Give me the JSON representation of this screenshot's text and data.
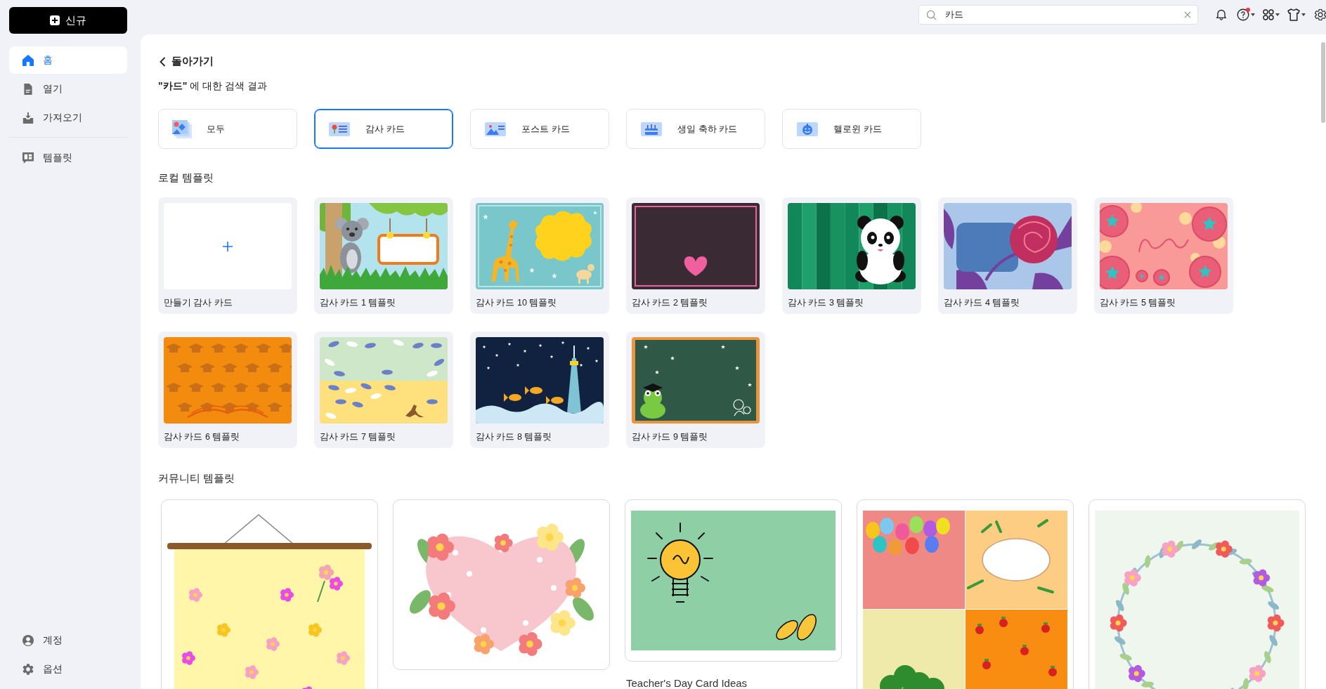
{
  "sidebar": {
    "new_button": "신규",
    "main_items": [
      {
        "label": "홈",
        "selected": true
      },
      {
        "label": "열기",
        "selected": false
      },
      {
        "label": "가져오기",
        "selected": false
      }
    ],
    "template_items": [
      {
        "label": "템플릿",
        "selected": false
      }
    ],
    "footer_items": [
      {
        "label": "계정",
        "selected": false
      },
      {
        "label": "옵션",
        "selected": false
      }
    ]
  },
  "header": {
    "search": {
      "value": "카드"
    },
    "help": {
      "notification": true
    }
  },
  "back_link": "돌아가기",
  "results_heading": "**\"카드\"** 에 대한 검색 결과",
  "categories": [
    {
      "label": "모두",
      "selected": false
    },
    {
      "label": "감사 카드",
      "selected": true
    },
    {
      "label": "포스트 카드",
      "selected": false
    },
    {
      "label": "생일 축하 카드",
      "selected": false
    },
    {
      "label": "핼로윈 카드",
      "selected": false
    }
  ],
  "local_templates": {
    "title": "로컬 템플릿",
    "create_card": "만들기 감사 카드",
    "items": [
      {
        "kind": "koala",
        "label": "감사 카드 1 템플릿"
      },
      {
        "kind": "giraffe",
        "label": "감사 카드 10 템플릿"
      },
      {
        "kind": "heart",
        "label": "감사 카드 2 템플릿"
      },
      {
        "kind": "panda",
        "label": "감사 카드 3 템플릿"
      },
      {
        "kind": "rose",
        "label": "감사 카드 4 템플릿"
      },
      {
        "kind": "dots",
        "label": "감사 카드 5 템플릿"
      },
      {
        "kind": "graduation",
        "label": "감사 카드 6 템플릿"
      },
      {
        "kind": "footprints",
        "label": "감사 카드 7 템플릿"
      },
      {
        "kind": "lighthouse",
        "label": "감사 카드 8 템플릿"
      },
      {
        "kind": "chalkboard",
        "label": "감사 카드 9 템플릿"
      }
    ]
  },
  "community_templates": {
    "title": "커뮤니티 템플릿",
    "items": [
      {
        "kind": "poster"
      },
      {
        "kind": "flowers"
      },
      {
        "kind": "bulb",
        "caption": "Teacher's Day Card Ideas"
      },
      {
        "kind": "quadrants"
      },
      {
        "kind": "wreath"
      }
    ]
  }
}
